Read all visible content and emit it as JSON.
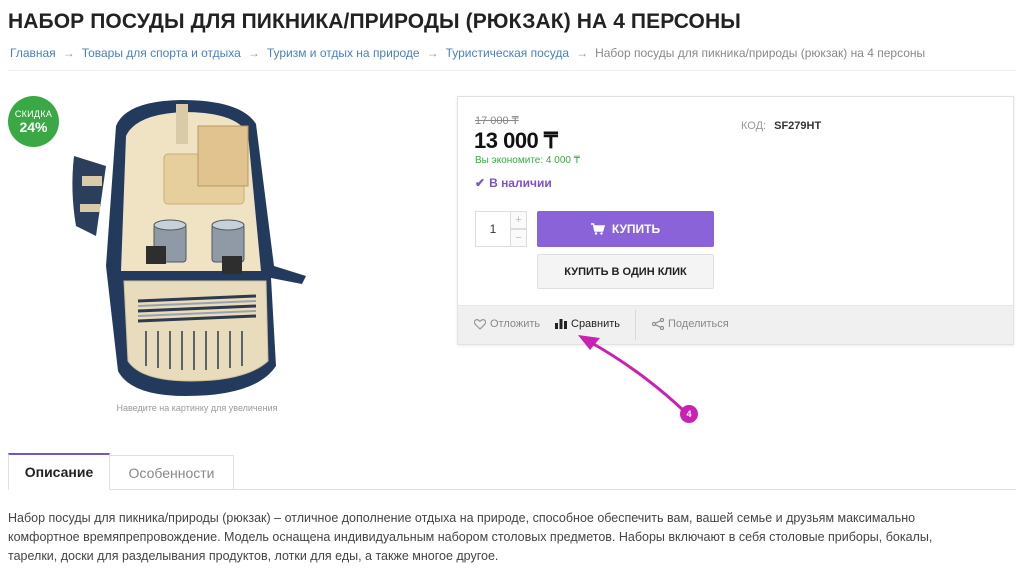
{
  "page": {
    "title": "НАБОР ПОСУДЫ ДЛЯ ПИКНИКА/ПРИРОДЫ (РЮКЗАК) НА 4 ПЕРСОНЫ"
  },
  "breadcrumb": {
    "separator": "→",
    "items": [
      "Главная",
      "Товары для спорта и отдыха",
      "Туризм и отдых на природе",
      "Туристическая посуда"
    ],
    "current": "Набор посуды для пикника/природы (рюкзак) на 4 персоны"
  },
  "badge": {
    "label": "СКИДКА",
    "value": "24%"
  },
  "image": {
    "hint": "Наведите на картинку для увеличения"
  },
  "buy_box": {
    "old_price": "17 000 ₸",
    "price": "13 000 ₸",
    "economy": "Вы экономите: 4 000 ₸",
    "stock": "В наличии",
    "sku_label": "КОД:",
    "sku_value": "SF279HT",
    "quantity": "1",
    "qty_plus": "+",
    "qty_minus": "−",
    "buy_label": "КУПИТЬ",
    "oneclick_label": "КУПИТЬ В ОДИН КЛИК"
  },
  "actions": {
    "wishlist": "Отложить",
    "compare": "Сравнить",
    "share": "Поделиться"
  },
  "annotation": {
    "number": "4"
  },
  "tabs": {
    "description": "Описание",
    "features": "Особенности"
  },
  "description": {
    "text": "Набор посуды для пикника/природы (рюкзак) – отличное дополнение отдыха на природе, способное обеспечить вам, вашей семье и друзьям максимально комфортное времяпрепровождение. Модель оснащена индивидуальным набором столовых предметов. Наборы включают в себя столовые приборы, бокалы, тарелки, доски для разделывания продуктов, лотки для еды, а также многое другое."
  },
  "colors": {
    "accent": "#8b63d8",
    "discount": "#3aa845",
    "annotation": "#c821b3",
    "link": "#4a7fc0"
  },
  "icons": [
    "heart-icon",
    "compare-chart-icon",
    "share-icon",
    "cart-icon",
    "check-icon"
  ]
}
